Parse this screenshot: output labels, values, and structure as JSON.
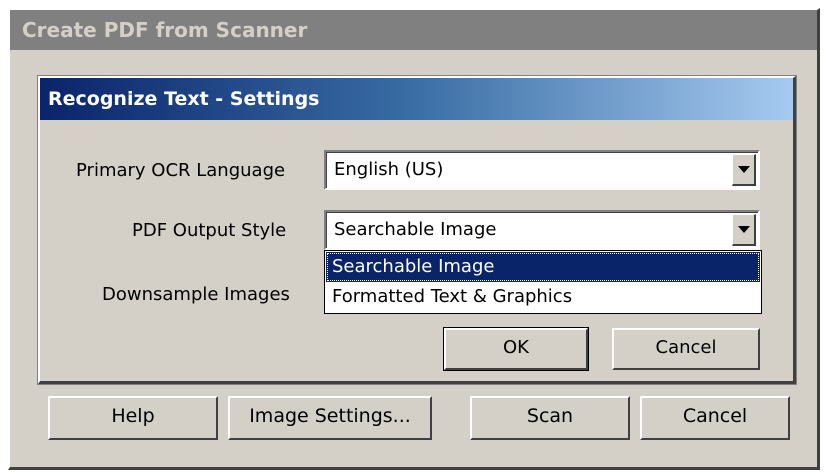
{
  "outer_dialog": {
    "title": "Create PDF from Scanner",
    "buttons": {
      "help": "Help",
      "image_settings": "Image Settings...",
      "scan": "Scan",
      "cancel": "Cancel"
    }
  },
  "inner_dialog": {
    "title": "Recognize Text - Settings",
    "fields": {
      "primary_ocr_language": {
        "label": "Primary OCR Language",
        "value": "English (US)"
      },
      "pdf_output_style": {
        "label": "PDF Output Style",
        "value": "Searchable Image"
      },
      "downsample_images": {
        "label": "Downsample Images"
      }
    },
    "dropdown_options": [
      "Searchable Image",
      "Formatted Text & Graphics"
    ],
    "selected_option_index": 0,
    "buttons": {
      "ok": "OK",
      "cancel": "Cancel"
    }
  },
  "colors": {
    "dialog_bg": "#d4d0c8",
    "active_title_start": "#0a246a",
    "active_title_end": "#a6caf0",
    "inactive_title": "#808080",
    "selection": "#0a246a"
  }
}
